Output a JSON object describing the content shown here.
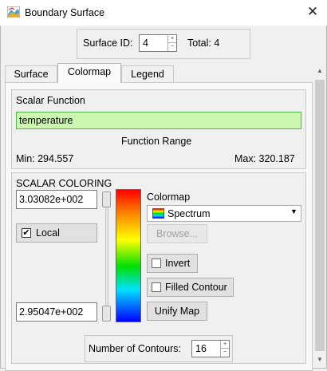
{
  "window": {
    "title": "Boundary Surface"
  },
  "header": {
    "surface_id_label": "Surface ID:",
    "surface_id_value": "4",
    "total_label": "Total: 4"
  },
  "tabs": [
    {
      "label": "Surface"
    },
    {
      "label": "Colormap",
      "active": true
    },
    {
      "label": "Legend"
    }
  ],
  "scalar_function": {
    "group_label": "Scalar Function",
    "value": "temperature",
    "range_label": "Function Range",
    "min_text": "Min:  294.557",
    "max_text": "Max:  320.187"
  },
  "scalar_coloring": {
    "group_label": "SCALAR COLORING",
    "max_value": "3.03082e+002",
    "min_value": "2.95047e+002",
    "local_label": "Local",
    "local_checked": true,
    "colormap_label": "Colormap",
    "colormap_selected": "Spectrum",
    "browse_label": "Browse...",
    "invert_label": "Invert",
    "filled_contour_label": "Filled Contour",
    "unify_label": "Unify Map",
    "contours_label": "Number of Contours:",
    "contours_value": "16"
  },
  "icons": {
    "close": "close-icon",
    "app": "surface-app-icon",
    "dropdown": "chevron-down-icon"
  },
  "colors": {
    "function_field_bg": "#ccf5b0",
    "function_field_border": "#55b54a"
  }
}
